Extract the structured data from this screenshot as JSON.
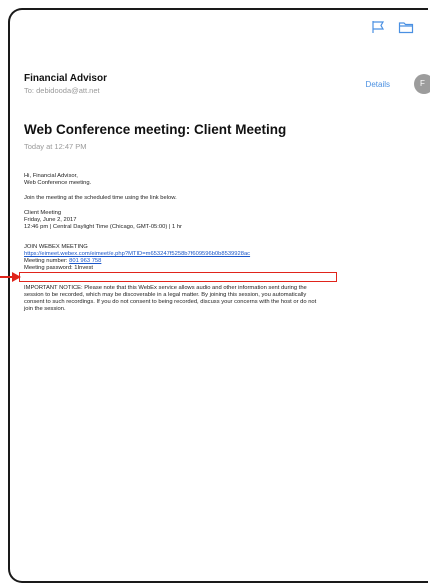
{
  "toolbar": {
    "icons": [
      "flag-icon",
      "folder-icon"
    ],
    "accent": "#4a90e2"
  },
  "header": {
    "sender": "Financial Advisor",
    "to_label": "To:",
    "to_address": "debidooda@att.net",
    "details_label": "Details",
    "avatar_initial": "F"
  },
  "subject": "Web Conference meeting: Client Meeting",
  "timestamp": "Today at 12:47 PM",
  "body": {
    "greeting_1": "Hi, Financial Advisor,",
    "greeting_2": "Web Conference meeting.",
    "instruction": "Join the meeting at the scheduled time using the link below.",
    "meeting_name": "Client Meeting",
    "meeting_date": "Friday, June 2, 2017",
    "meeting_time": "12:46 pm | Central Daylight Time (Chicago, GMT-05:00) | 1 hr",
    "join_heading": "JOIN WEBEX MEETING",
    "join_link": "https://eimeet.webex.com/eimeet/e.php?MTID=m653247f5258b7f609596b0b8539928ac",
    "meeting_number_label": "Meeting number:",
    "meeting_number": "801 963 758",
    "meeting_password_label": "Meeting password:",
    "meeting_password": "1Invest",
    "notice_1": "IMPORTANT NOTICE: Please note that this WebEx service allows audio and other information sent during the",
    "notice_2": "session to be recorded, which may be discoverable in a legal matter. By joining this session, you automatically",
    "notice_3": "consent to such recordings. If you do not consent to being recorded, discuss your concerns with the host or do not",
    "notice_4": "join the session."
  },
  "annotation_color": "#e0241b"
}
